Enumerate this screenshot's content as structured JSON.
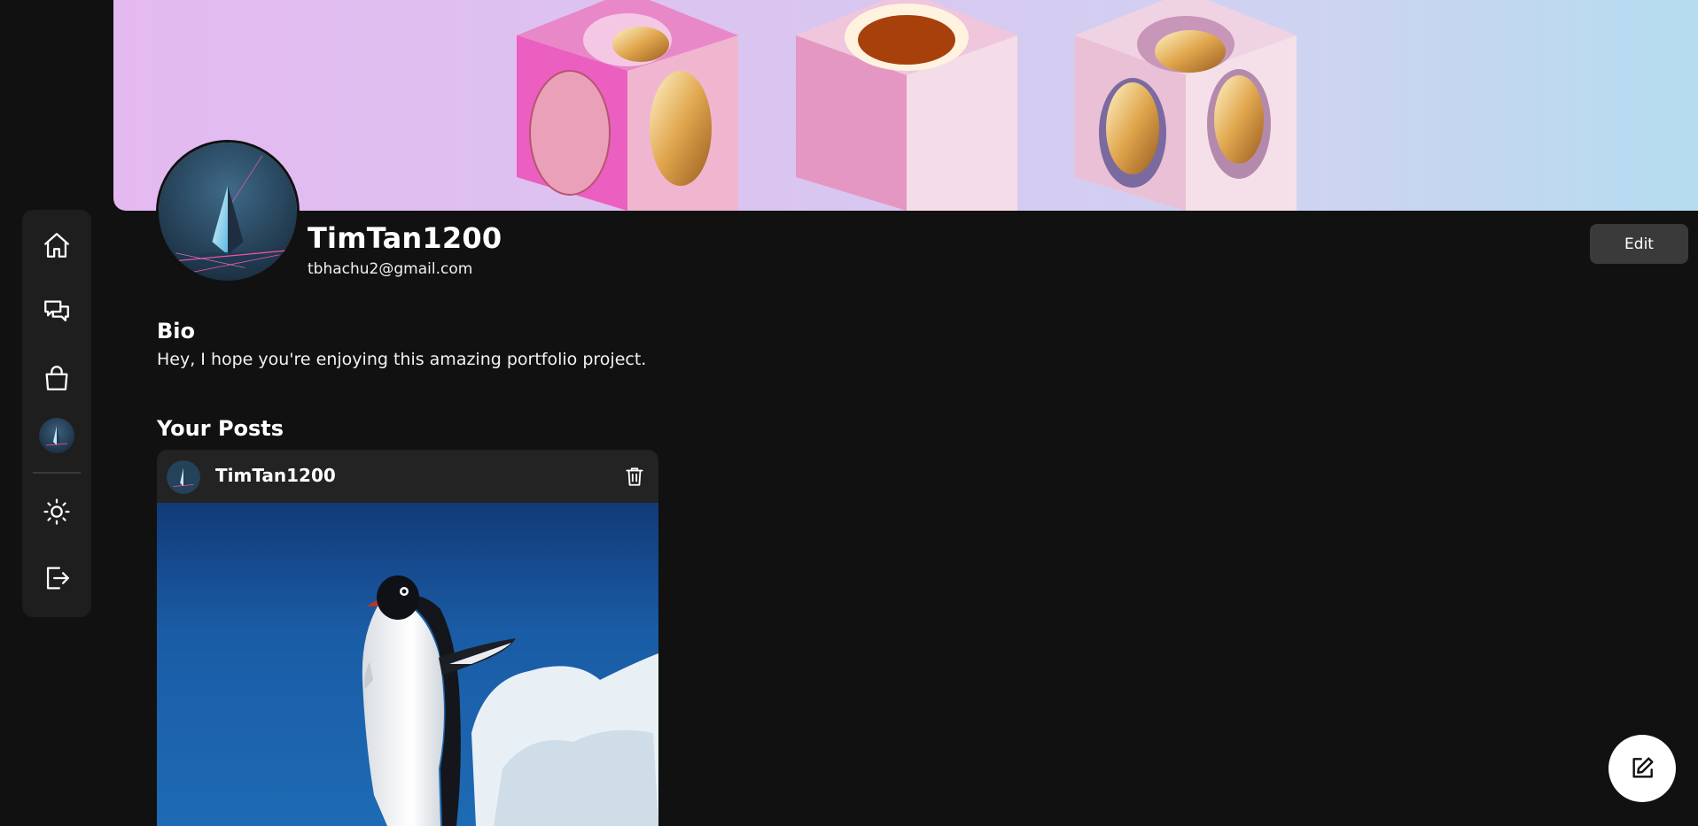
{
  "profile": {
    "username": "TimTan1200",
    "email": "tbhachu2@gmail.com",
    "edit_label": "Edit"
  },
  "bio": {
    "heading": "Bio",
    "text": "Hey, I hope you're enjoying this amazing portfolio project."
  },
  "posts": {
    "heading": "Your Posts",
    "items": [
      {
        "author": "TimTan1200",
        "image_alt": "penguin-on-ice"
      }
    ]
  },
  "sidebar": {
    "items": [
      {
        "icon": "home-icon"
      },
      {
        "icon": "chat-icon"
      },
      {
        "icon": "shopping-bag-icon"
      },
      {
        "icon": "avatar"
      },
      {
        "icon": "sun-icon"
      },
      {
        "icon": "logout-icon"
      }
    ]
  },
  "fab": {
    "icon": "edit-icon"
  },
  "colors": {
    "background": "#111111",
    "sidebar": "#1e1e1e",
    "card": "#232323",
    "edit_button": "#3a3a3a"
  }
}
